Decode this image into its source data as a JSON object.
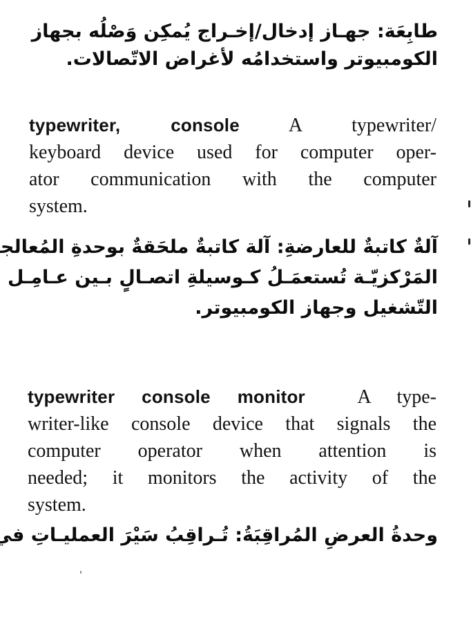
{
  "entries": [
    {
      "arabic_definition_lines": [
        "طابِعَة: جهـاز إدخال/إخـراج يُمكِن وَصْلُه بجهاز",
        "الكومبيوتر واستخدامُه لأغراض الاتّصالات."
      ]
    },
    {
      "term": "typewriter, console",
      "definition_first_line_rest": "A typewriter/",
      "definition_lines": [
        "keyboard device used for computer oper-",
        "ator communication with the computer",
        "system."
      ],
      "arabic_lines": [
        "آلةٌ كاتبةٌ للعارضةِ: آلة كاتبةٌ ملحَقةٌ بوحدةِ المُعالجةِ",
        "المَرْكزيّـة تُستعمَـلُ كـوسيلةِ اتصـالٍ بـين عـامِـل",
        "التّشغيل وجهاز الكومبيوتر."
      ]
    },
    {
      "term": "typewriter console monitor",
      "definition_first_line_rest": "A type-",
      "definition_lines": [
        "writer-like console device that signals the",
        "computer operator when attention is",
        "needed; it monitors the activity of the",
        "system."
      ],
      "arabic_lines": [
        "وحدةُ العرضِ المُراقِبَةُ: تُـراقِبُ سَيْرَ العمليـاتِ في"
      ]
    }
  ]
}
